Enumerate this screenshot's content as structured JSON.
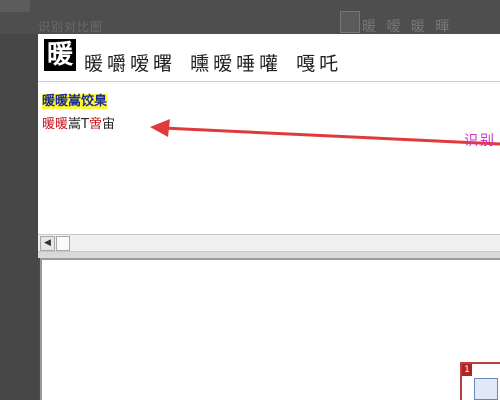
{
  "header": {
    "faded_left_text": "识别对比图",
    "faded_right_text": "暖 嗳 暖 暉"
  },
  "candidate_bar": {
    "source_glyph": "暖",
    "candidates_group1": [
      "暖",
      "嚼",
      "嗳",
      "曙"
    ],
    "candidates_group2": [
      "曛",
      "暧",
      "唾",
      "嚾"
    ],
    "candidates_group3": [
      "嘎",
      "吒"
    ]
  },
  "upper_panel": {
    "highlighted_line": "暖暖嵩饺臬",
    "result_line": {
      "part1_red": "暖暖",
      "part2_black": "嵩",
      "part3_black": "T",
      "part4_red": "啻",
      "part5_black": "宙"
    },
    "annotation": "识别"
  },
  "lower_panel": {
    "thumbnail_number": "1"
  },
  "colors": {
    "highlight_bg": "#fffb33",
    "highlight_text": "#1a2a9a",
    "error_red": "#c4141b",
    "annotation_magenta": "#cc33cc",
    "arrow_red": "#e03a3a"
  }
}
